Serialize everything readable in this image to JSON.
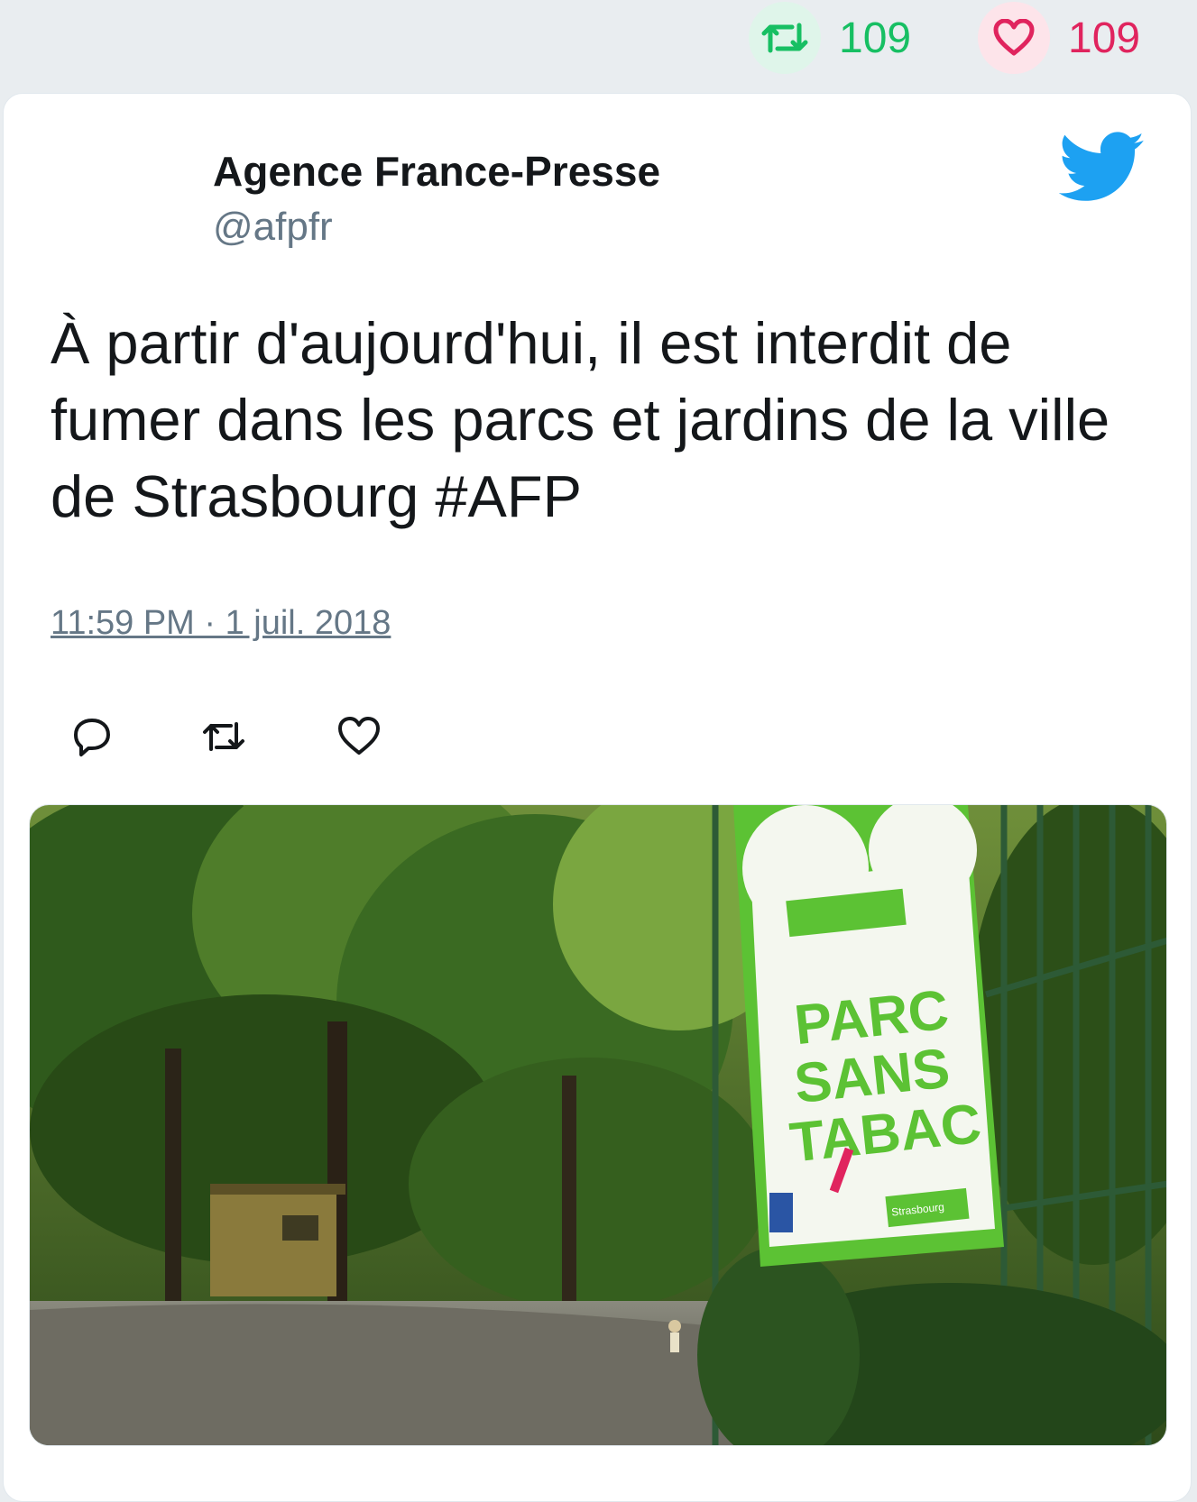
{
  "stats": {
    "retweet_count": "109",
    "like_count": "109"
  },
  "tweet": {
    "author_name": "Agence France-Presse",
    "author_handle": "@afpfr",
    "text": "À partir d'aujourd'hui, il est interdit de fumer dans les parcs et jardins de la ville de Strasbourg #AFP",
    "timestamp": "11:59 PM · 1 juil. 2018"
  },
  "media": {
    "sign_line1": "PARC",
    "sign_line2": "SANS",
    "sign_line3": "TABAC",
    "sign_city": "Strasbourg"
  },
  "colors": {
    "retweet_green": "#17bf63",
    "like_red": "#e0245e",
    "twitter_blue": "#1da1f2",
    "sign_green": "#5cc234"
  },
  "icons": [
    "retweet-icon",
    "heart-icon",
    "twitter-bird-icon",
    "reply-icon"
  ]
}
